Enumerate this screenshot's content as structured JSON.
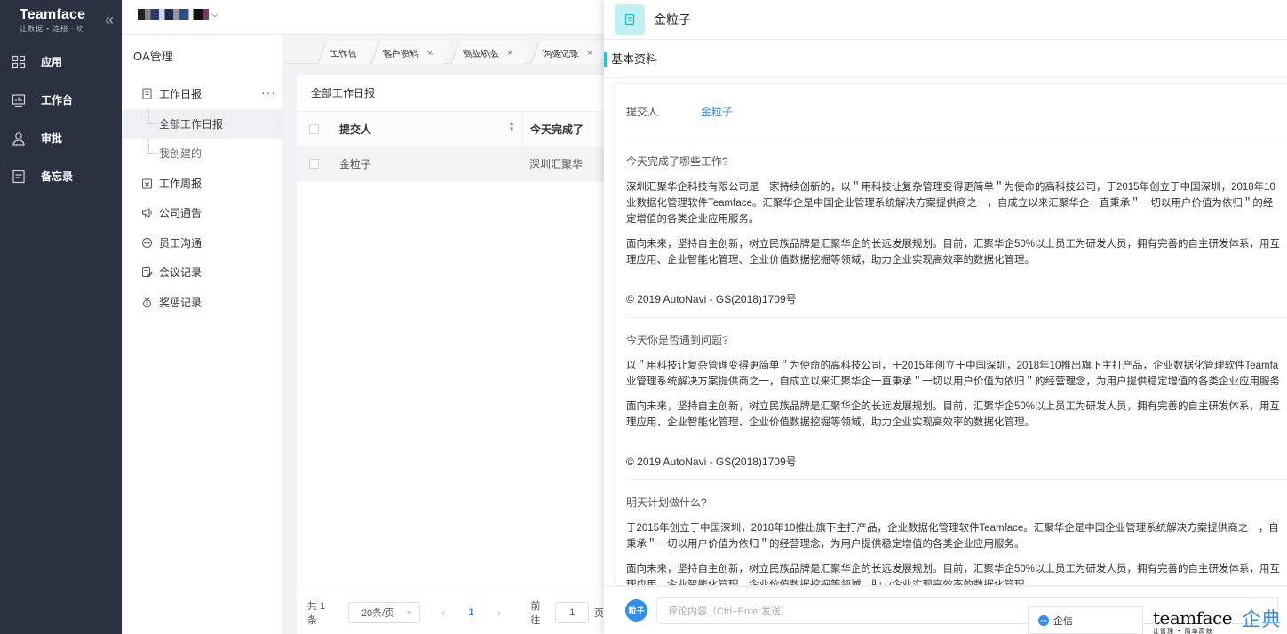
{
  "brand": {
    "name": "Teamface",
    "slogan": "让数据 • 连接一切"
  },
  "nav": [
    {
      "label": "应用",
      "icon": "grid-icon"
    },
    {
      "label": "工作台",
      "icon": "dashboard-icon"
    },
    {
      "label": "审批",
      "icon": "user-icon"
    },
    {
      "label": "备忘录",
      "icon": "note-icon"
    }
  ],
  "oa": {
    "title": "OA管理",
    "daily": "工作日报",
    "sub_all": "全部工作日报",
    "sub_mine": "我创建的",
    "weekly": "工作周报",
    "notice": "公司通告",
    "chat": "员工沟通",
    "meeting": "会议记录",
    "reward": "奖惩记录"
  },
  "tabs": [
    {
      "label": "工作台",
      "closable": false
    },
    {
      "label": "客户资料",
      "closable": true
    },
    {
      "label": "商业机会",
      "closable": true
    },
    {
      "label": "沟通记录",
      "closable": true
    }
  ],
  "list": {
    "title": "全部工作日报",
    "col_submitter": "提交人",
    "col_today": "今天完成了",
    "row_submitter": "金粒子",
    "row_today": "深圳汇聚华"
  },
  "pager": {
    "total": "共 1 条",
    "size": "20条/页",
    "current": "1",
    "goto": "前往",
    "goto_val": "1",
    "unit": "页"
  },
  "drawer": {
    "name": "金粒子",
    "section": "基本资料",
    "submitter_label": "提交人",
    "submitter_value": "金粒子",
    "q1": "今天完成了哪些工作?",
    "q1_p1_l1": "深圳汇聚华企科技有限公司是一家持续创新的，以＂用科技让复杂管理变得更简单＂为使命的高科技公司，于2015年创立于中国深圳，2018年10",
    "q1_p1_l2": "业数据化管理软件Teamface。汇聚华企是中国企业管理系统解决方案提供商之一，自成立以来汇聚华企一直秉承＂一切以用户价值为依归＂的经",
    "q1_p1_l3": "定增值的各类企业应用服务。",
    "p_future_l1": "面向未来，坚持自主创新，树立民族品牌是汇聚华企的长远发展规划。目前，汇聚华企50%以上员工为研发人员，拥有完善的自主研发体系，用互",
    "p_future_l2": "理应用、企业智能化管理、企业价值数据挖掘等领域，助力企业实现高效率的数据化管理。",
    "copyright": "© 2019 AutoNavi - GS(2018)1709号",
    "q2": "今天你是否遇到问题?",
    "q2_p1_l1": "以＂用科技让复杂管理变得更简单＂为使命的高科技公司，于2015年创立于中国深圳，2018年10推出旗下主打产品，企业数据化管理软件Teamfa",
    "q2_p1_l2": "业管理系统解决方案提供商之一，自成立以来汇聚华企一直秉承＂一切以用户价值为依归＂的经营理念，为用户提供稳定增值的各类企业应用服务",
    "q3": "明天计划做什么?",
    "q3_p1_l1": "于2015年创立于中国深圳，2018年10推出旗下主打产品，企业数据化管理软件Teamface。汇聚华企是中国企业管理系统解决方案提供商之一，自",
    "q3_p1_l2": "秉承＂一切以用户价值为依归＂的经营理念，为用户提供稳定增值的各类企业应用服务。",
    "avatar": "粒子",
    "comment_placeholder": "评论内容（Ctrl+Enter发送）",
    "qixin": "企信"
  },
  "watermark": {
    "text": "teamface",
    "sub": "让管理 • 简单高效",
    "cn": "企典"
  },
  "colors": {
    "sidebar": "#2b3140",
    "accent": "#3a8be8",
    "teal": "#26c6cf"
  }
}
